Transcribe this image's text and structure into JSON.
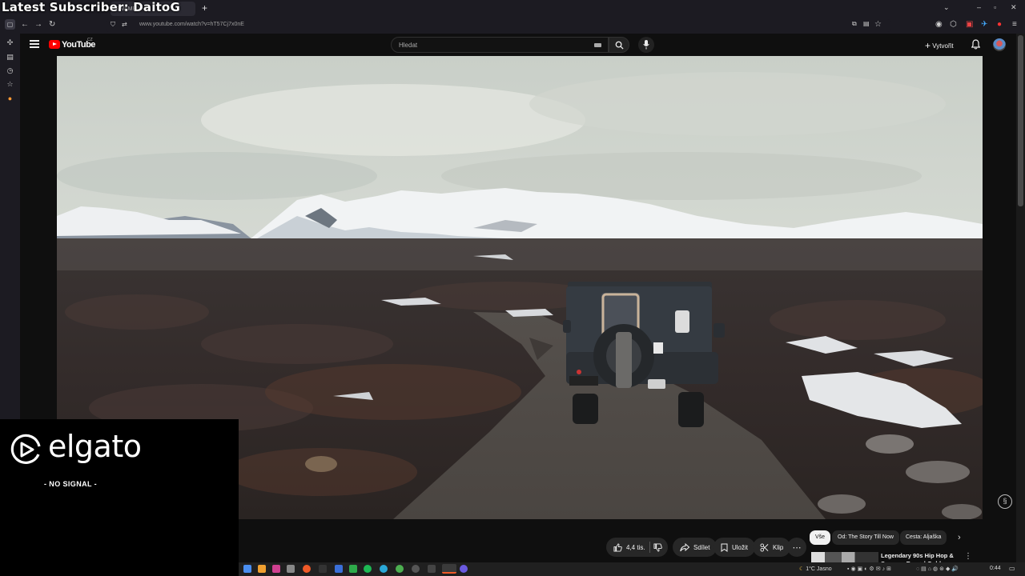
{
  "overlay": {
    "subscriber": "Latest Subscriber: DaitoG"
  },
  "browser": {
    "tab_title": "SWAMP",
    "new_tab_symbol": "+",
    "url": "www.youtube.com/watch?v=hT57Cj7x0nE"
  },
  "youtube": {
    "logo_text": "YouTube",
    "country_code": "CZ",
    "search_placeholder": "Hledat",
    "create_label": "Vytvořit"
  },
  "video_actions": {
    "like_count": "4,4 tis.",
    "share_label": "Sdílet",
    "save_label": "Uložit",
    "clip_label": "Klip",
    "more_symbol": "⋯"
  },
  "chips": [
    "Vše",
    "Od: The Story Till Now",
    "Cesta: Aljaška"
  ],
  "recommendation": {
    "title_line1": "Legendary 90s Hip Hop &",
    "title_line2": "Sunrays Rap ♪ | Golden Era"
  },
  "elgato": {
    "brand": "elgato",
    "status": "- NO SIGNAL -"
  },
  "taskbar": {
    "weather": "1°C  Jasno",
    "time": "0:44"
  }
}
